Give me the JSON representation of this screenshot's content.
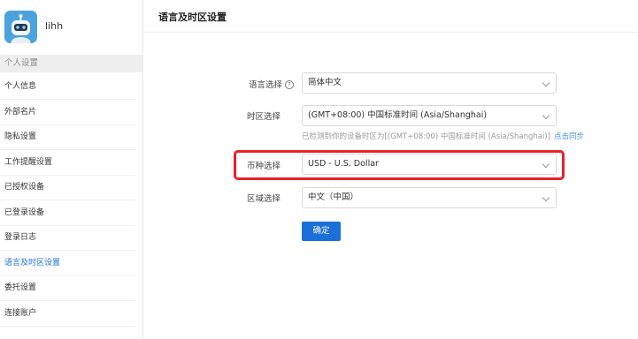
{
  "user": {
    "name": "lihh"
  },
  "sidebar": {
    "section_header": "个人设置",
    "items": [
      {
        "label": "个人信息",
        "active": false
      },
      {
        "label": "外部名片",
        "active": false
      },
      {
        "label": "隐私设置",
        "active": false
      },
      {
        "label": "工作提醒设置",
        "active": false
      },
      {
        "label": "已授权设备",
        "active": false
      },
      {
        "label": "已登录设备",
        "active": false
      },
      {
        "label": "登录日志",
        "active": false
      },
      {
        "label": "语言及时区设置",
        "active": true
      },
      {
        "label": "委托设置",
        "active": false
      },
      {
        "label": "连接账户",
        "active": false
      }
    ]
  },
  "main": {
    "title": "语言及时区设置",
    "form": {
      "language": {
        "label": "语言选择",
        "help_icon": "?",
        "value": "简体中文"
      },
      "timezone": {
        "label": "时区选择",
        "value": "(GMT+08:00) 中国标准时间 (Asia/Shanghai)"
      },
      "timezone_hint": {
        "text": "已检测到你的设备时区为[(GMT+08:00) 中国标准时间 (Asia/Shanghai)]",
        "link": "点击同步"
      },
      "currency": {
        "label": "币种选择",
        "value": "USD - U.S. Dollar"
      },
      "region": {
        "label": "区域选择",
        "value": "中文（中国）"
      }
    },
    "confirm_label": "确定"
  },
  "colors": {
    "accent": "#1a6fd9",
    "highlight": "#e8202a",
    "link": "#4a90e2"
  }
}
